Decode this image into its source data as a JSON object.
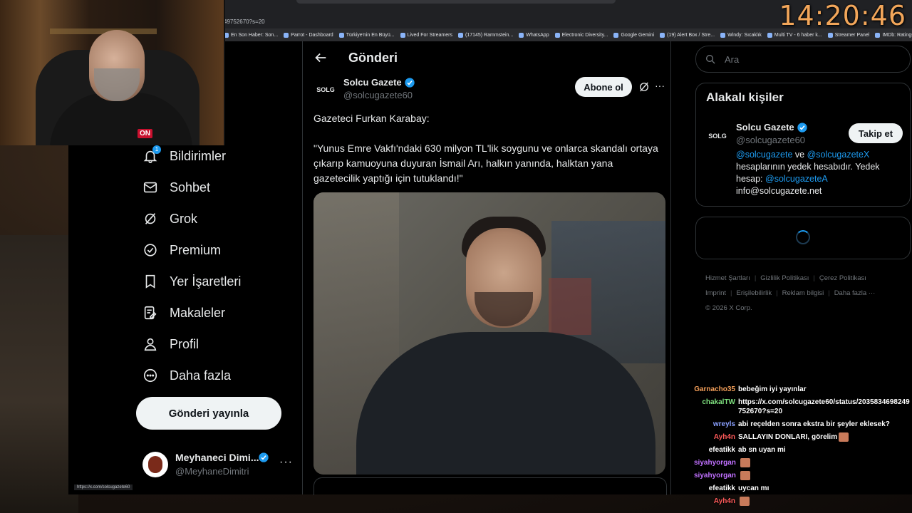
{
  "clock": "14:20:46",
  "browser": {
    "url_fragment": "4975267​0?s=20",
    "bookmarks": [
      "En Son Haber: Son...",
      "Parrot - Dashboard",
      "Türkiye'nin En Büyü...",
      "Lived For Streamers",
      "(17145) Rammstein...",
      "WhatsApp",
      "Electronic Diversity...",
      "Google Gemini",
      "(19) Alert Box / Stre...",
      "Windy: Sıcaklık",
      "Multi TV - 6 haber k...",
      "Streamer Panel",
      "IMDb: Ratings, Revi..."
    ],
    "status_url": "https://x.com/solcugazete60"
  },
  "nav": {
    "items": [
      {
        "label": "Bildirimler",
        "icon": "bell-icon",
        "badge": "1"
      },
      {
        "label": "Sohbet",
        "icon": "mail-icon"
      },
      {
        "label": "Grok",
        "icon": "grok-icon"
      },
      {
        "label": "Premium",
        "icon": "verified-badge-icon"
      },
      {
        "label": "Yer İşaretleri",
        "icon": "bookmark-icon"
      },
      {
        "label": "Makaleler",
        "icon": "article-icon"
      },
      {
        "label": "Profil",
        "icon": "person-icon"
      },
      {
        "label": "Daha fazla",
        "icon": "more-circle-icon"
      }
    ],
    "post_button": "Gönderi yayınla",
    "account": {
      "name": "Meyhaneci Dimi...",
      "handle": "@MeyhaneDimitri"
    }
  },
  "post": {
    "header_title": "Gönderi",
    "author_name": "Solcu Gazete",
    "author_handle": "@solcugazete60",
    "author_logo": "SOLG",
    "subscribe_label": "Abone ol",
    "text": "Gazeteci Furkan Karabay:\n\n\"Yunus Emre Vakfı'ndaki 630 milyon TL'lik soygunu ve onlarca skandalı ortaya çıkarıp kamuoyuna duyuran İsmail Arı, halkın yanında, halktan yana gazetecilik yaptığı için tutuklandı!\""
  },
  "sidebar": {
    "search_placeholder": "Ara",
    "related_title": "Alakalı kişiler",
    "related_name": "Solcu Gazete",
    "related_handle": "@solcugazete60",
    "related_logo": "SOLG",
    "follow_label": "Takip et",
    "bio_link1": "@solcugazete",
    "bio_and": " ve ",
    "bio_link2": "@solcugazeteX",
    "bio_mid": " hesaplarının yedek hesabıdır. Yedek hesap: ",
    "bio_link3": "@solcugazeteA",
    "bio_email": "info@solcugazete.net",
    "footer_row1": [
      "Hizmet Şartları",
      "Gizlilik Politikası",
      "Çerez Politikası"
    ],
    "footer_row2": [
      "Imprint",
      "Erişilebilirlik",
      "Reklam bilgisi",
      "Daha fazla ···"
    ],
    "copyright": "© 2026 X Corp."
  },
  "chat": [
    {
      "user": "Garnacho35",
      "color": "#f5a05a",
      "msg": "bebeğim iyi yayınlar"
    },
    {
      "user": "chakalTW",
      "color": "#7ee07e",
      "msg": "https://x.com/solcugazete60/status/2035834698249752670?s=20"
    },
    {
      "user": "wreyls",
      "color": "#8aa0ff",
      "msg": "abi reçelden sonra ekstra bir şeyler eklesek?"
    },
    {
      "user": "Ayh4n",
      "color": "#ff5a5a",
      "msg": "SALLAYIN DONLARI, görelim"
    },
    {
      "user": "efeatikk",
      "color": "#ffffff",
      "msg": "ab sn uyan mi"
    },
    {
      "user": "siyahyorgan",
      "color": "#c070ff",
      "msg": ""
    },
    {
      "user": "siyahyorgan",
      "color": "#c070ff",
      "msg": ""
    },
    {
      "user": "efeatikk",
      "color": "#ffffff",
      "msg": "uycan mı"
    },
    {
      "user": "Ayh4n",
      "color": "#ff5a5a",
      "msg": ""
    }
  ]
}
